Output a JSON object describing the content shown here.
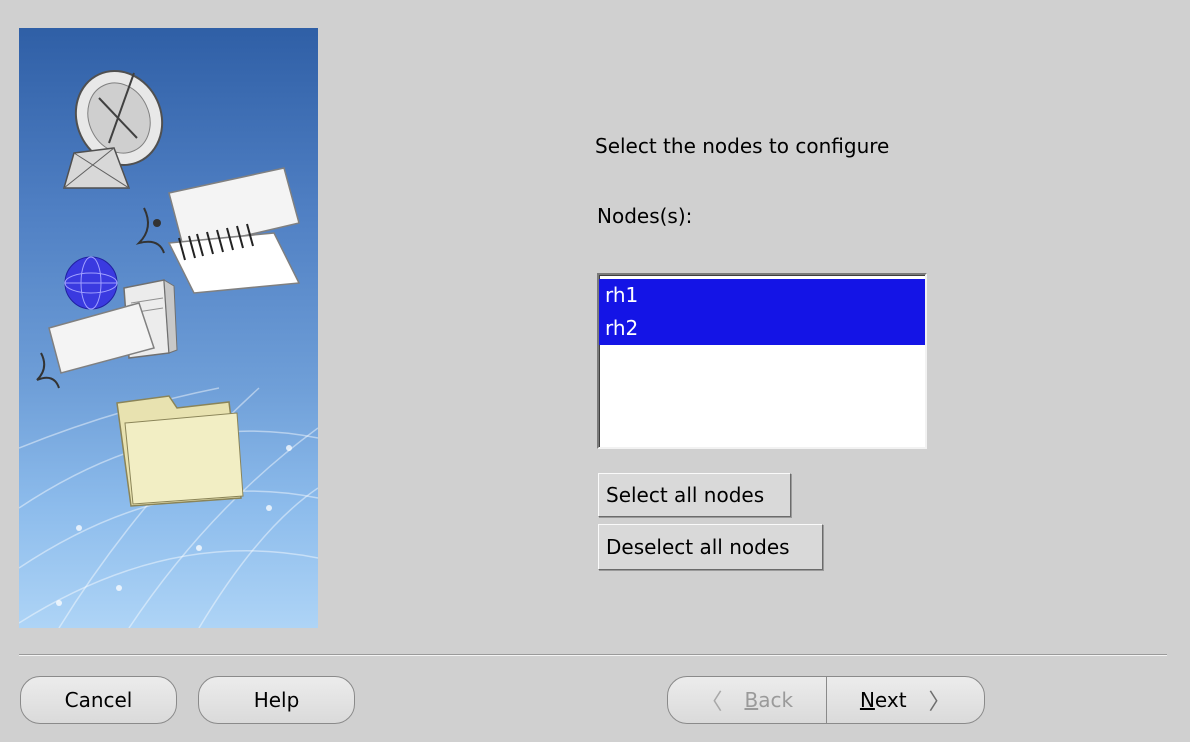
{
  "prompt": "Select the nodes to configure",
  "nodes_label": "Nodes(s):",
  "nodes": [
    {
      "label": "rh1",
      "selected": true
    },
    {
      "label": "rh2",
      "selected": true
    }
  ],
  "buttons": {
    "select_all": "Select all nodes",
    "deselect_all": "Deselect all nodes",
    "cancel": "Cancel",
    "help": "Help",
    "back_mnemonic": "B",
    "back_rest": "ack",
    "next_mnemonic": "N",
    "next_rest": "ext"
  },
  "colors": {
    "selection": "#1414e6",
    "background": "#d0d0d0"
  }
}
